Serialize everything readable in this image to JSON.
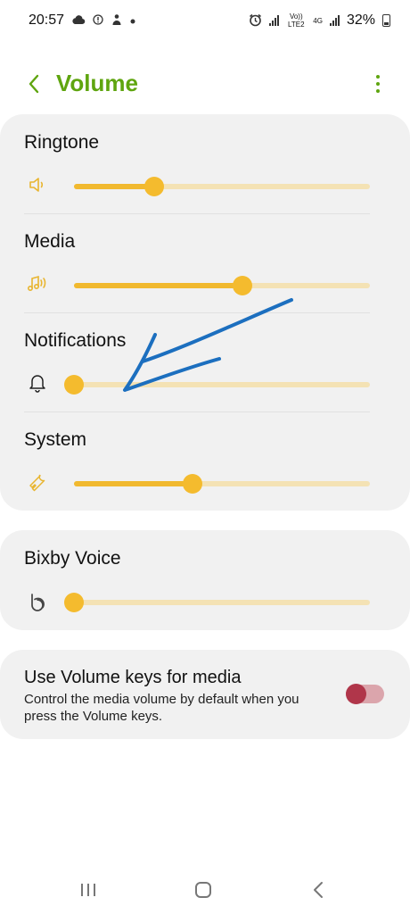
{
  "status_bar": {
    "time": "20:57",
    "network": "Vo)) LTE2",
    "network_type": "4G",
    "battery": "32%"
  },
  "header": {
    "title": "Volume"
  },
  "volume": {
    "rows": [
      {
        "label": "Ringtone",
        "icon": "speaker-icon",
        "level": 0.27
      },
      {
        "label": "Media",
        "icon": "music-note-icon",
        "level": 0.57
      },
      {
        "label": "Notifications",
        "icon": "bell-icon",
        "level": 0.0
      },
      {
        "label": "System",
        "icon": "wrench-icon",
        "level": 0.4
      }
    ]
  },
  "bixby": {
    "label": "Bixby Voice",
    "icon": "bixby-icon",
    "level": 0.0
  },
  "volume_keys": {
    "title": "Use Volume keys for media",
    "description": "Control the media volume by default when you press the Volume keys.",
    "enabled": true
  },
  "colors": {
    "accent": "#5fa50f",
    "slider_fill": "#f1b92f",
    "slider_track": "#f4e2b4",
    "toggle_on": "#b0364a",
    "annotation": "#1c6fbf"
  }
}
